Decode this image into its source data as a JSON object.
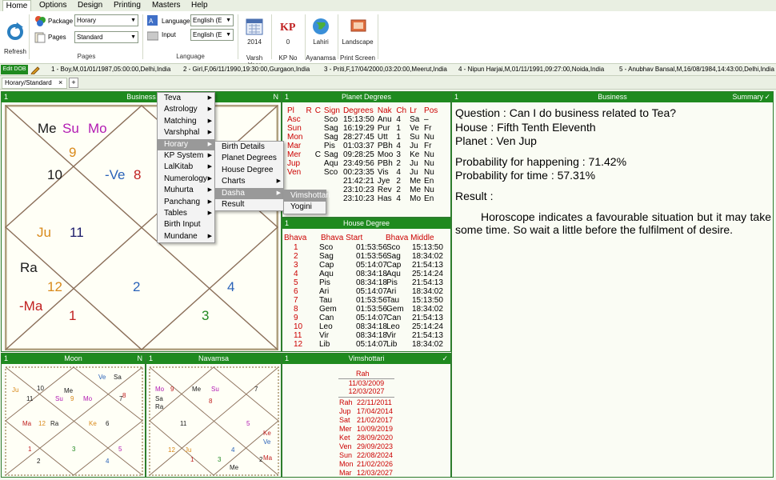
{
  "ribbon_tabs": [
    "Home",
    "Options",
    "Design",
    "Printing",
    "Masters",
    "Help"
  ],
  "ribbon": {
    "refresh_label": "Refresh",
    "package_label": "Package",
    "package_value": "Horary",
    "pages_label": "Pages",
    "pages_value": "Standard",
    "pages_group": "Pages",
    "language_label": "Language",
    "language_value": "English (E",
    "input_label": "Input",
    "input_value": "English (E",
    "language_group": "Language",
    "year_value": "2014",
    "varsh_label": "Varsh Year",
    "kp_value": "0",
    "kp_label": "KP No",
    "ayanamsa_value": "Lahiri",
    "ayanamsa_label": "Ayanamsa",
    "print_value": "Landscape",
    "print_label": "Print Screen"
  },
  "dob_bar": {
    "edit_label": "Edit DOB",
    "entries": [
      "1 - Boy,M,01/01/1987,05:00:00,Delhi,India",
      "2 - Girl,F,06/11/1990,19:30:00,Gurgaon,India",
      "3 - Priti,F,17/04/2000,03:20:00,Meerut,India",
      "4 - Nipun Harjai,M,01/11/1991,09:27:00,Noida,India",
      "5 - Anubhav Bansal,M,16/08/1984,14:43:00,Delhi,India"
    ]
  },
  "doc_tab": {
    "label": "Horary/Standard",
    "close": "×",
    "add": "+"
  },
  "business_panel": {
    "num": "1",
    "title": "Business",
    "right": "N",
    "texts": [
      {
        "t": "Me",
        "c": "#1a1a1a"
      },
      {
        "t": "Su",
        "c": "#b21ab2"
      },
      {
        "t": "Mo",
        "c": "#b21ab2"
      },
      {
        "t": "9",
        "c": "#d98a1a"
      },
      {
        "t": "10",
        "c": "#1a1a1a"
      },
      {
        "t": "-Ve",
        "c": "#2a62b8"
      },
      {
        "t": "8",
        "c": "#c02020"
      },
      {
        "t": "Ju",
        "c": "#d98a1a"
      },
      {
        "t": "11",
        "c": "#1a1a6a"
      },
      {
        "t": "Ra",
        "c": "#1a1a1a"
      },
      {
        "t": "12",
        "c": "#d98a1a"
      },
      {
        "t": "-Ma",
        "c": "#c02020"
      },
      {
        "t": "1",
        "c": "#c02020"
      },
      {
        "t": "2",
        "c": "#2a62b8"
      },
      {
        "t": "4",
        "c": "#2a62b8"
      },
      {
        "t": "3",
        "c": "#238a23"
      }
    ]
  },
  "menu_main": [
    "Teva",
    "Astrology",
    "Matching",
    "Varshphal",
    "Horary",
    "KP System",
    "LalKitab",
    "Numerology",
    "Muhurta",
    "Panchang",
    "Tables",
    "Birth Input",
    "Mundane"
  ],
  "menu_horary": [
    "Birth Details",
    "Planet Degrees",
    "House Degree",
    "Charts",
    "Dasha",
    "Result"
  ],
  "menu_dasha": [
    "Vimshottari",
    "Yogini"
  ],
  "planet_panel": {
    "num": "1",
    "title": "Planet Degrees",
    "headers": [
      "Pl",
      "R",
      "C",
      "Sign",
      "Degrees",
      "Nak",
      "Ch",
      "Lr",
      "Pos"
    ],
    "rows": [
      [
        "Asc",
        "",
        "",
        "Sco",
        "15:13:50",
        "Anu",
        "4",
        "Sa",
        "–"
      ],
      [
        "Sun",
        "",
        "",
        "Sag",
        "16:19:29",
        "Pur",
        "1",
        "Ve",
        "Fr"
      ],
      [
        "Mon",
        "",
        "",
        "Sag",
        "28:27:45",
        "Utt",
        "1",
        "Su",
        "Nu"
      ],
      [
        "Mar",
        "",
        "",
        "Pis",
        "01:03:37",
        "PBh",
        "4",
        "Ju",
        "Fr"
      ],
      [
        "Mer",
        "",
        "C",
        "Sag",
        "09:28:25",
        "Moo",
        "3",
        "Ke",
        "Nu"
      ],
      [
        "Jup",
        "",
        "",
        "Aqu",
        "23:49:56",
        "PBh",
        "2",
        "Ju",
        "Nu"
      ],
      [
        "Ven",
        "",
        "",
        "Sco",
        "00:23:35",
        "Vis",
        "4",
        "Ju",
        "Nu"
      ],
      [
        "",
        "",
        "",
        "",
        "21:42:21",
        "Jye",
        "2",
        "Me",
        "En"
      ],
      [
        "",
        "",
        "",
        "",
        "23:10:23",
        "Rev",
        "2",
        "Me",
        "Nu"
      ],
      [
        "",
        "",
        "",
        "",
        "23:10:23",
        "Has",
        "4",
        "Mo",
        "En"
      ]
    ]
  },
  "house_panel": {
    "num": "1",
    "title": "House Degree",
    "headers": [
      "Bhava",
      "Bhava Start",
      "Bhava Middle"
    ],
    "rows": [
      [
        "1",
        "Sco",
        "01:53:56",
        "Sco",
        "15:13:50"
      ],
      [
        "2",
        "Sag",
        "01:53:56",
        "Sag",
        "18:34:02"
      ],
      [
        "3",
        "Cap",
        "05:14:07",
        "Cap",
        "21:54:13"
      ],
      [
        "4",
        "Aqu",
        "08:34:18",
        "Aqu",
        "25:14:24"
      ],
      [
        "5",
        "Pis",
        "08:34:18",
        "Pis",
        "21:54:13"
      ],
      [
        "6",
        "Ari",
        "05:14:07",
        "Ari",
        "18:34:02"
      ],
      [
        "7",
        "Tau",
        "01:53:56",
        "Tau",
        "15:13:50"
      ],
      [
        "8",
        "Gem",
        "01:53:56",
        "Gem",
        "18:34:02"
      ],
      [
        "9",
        "Can",
        "05:14:07",
        "Can",
        "21:54:13"
      ],
      [
        "10",
        "Leo",
        "08:34:18",
        "Leo",
        "25:14:24"
      ],
      [
        "11",
        "Vir",
        "08:34:18",
        "Vir",
        "21:54:13"
      ],
      [
        "12",
        "Lib",
        "05:14:07",
        "Lib",
        "18:34:02"
      ]
    ]
  },
  "result_panel": {
    "num": "1",
    "title": "Business",
    "right": "Summary",
    "question": "Question : Can I do business related to Tea?",
    "house": "House : Fifth Tenth Eleventh",
    "planet": "Planet : Ven Jup",
    "prob_happen": "Probability for happening : 71.42%",
    "prob_time": "Probability for time : 57.31%",
    "result_label": "Result :",
    "result_text": "Horoscope indicates a favourable situation but it may take some time. So wait a little before the fulfilment of desire."
  },
  "moon_panel": {
    "num": "1",
    "title": "Moon",
    "right": "N",
    "texts": [
      {
        "t": "Ve",
        "c": "#2a62b8"
      },
      {
        "t": "Sa",
        "c": "#1a1a1a"
      },
      {
        "t": "10",
        "c": "#1a1a1a"
      },
      {
        "t": "Ju",
        "c": "#d98a1a"
      },
      {
        "t": "Me",
        "c": "#1a1a1a"
      },
      {
        "t": "8",
        "c": "#c02020"
      },
      {
        "t": "11",
        "c": "#1a1a1a"
      },
      {
        "t": "Su",
        "c": "#b21ab2"
      },
      {
        "t": "9",
        "c": "#d98a1a"
      },
      {
        "t": "Mo",
        "c": "#b21ab2"
      },
      {
        "t": "7",
        "c": "#1a1a1a"
      },
      {
        "t": "Ma",
        "c": "#c02020"
      },
      {
        "t": "12",
        "c": "#d98a1a"
      },
      {
        "t": "Ra",
        "c": "#1a1a1a"
      },
      {
        "t": "Ke",
        "c": "#d98a1a"
      },
      {
        "t": "6",
        "c": "#1a1a1a"
      },
      {
        "t": "1",
        "c": "#c02020"
      },
      {
        "t": "3",
        "c": "#238a23"
      },
      {
        "t": "5",
        "c": "#b21ab2"
      },
      {
        "t": "2",
        "c": "#1a1a1a"
      },
      {
        "t": "4",
        "c": "#2a62b8"
      }
    ]
  },
  "navamsa_panel": {
    "num": "1",
    "title": "Navamsa",
    "texts": [
      {
        "t": "Mo",
        "c": "#b21ab2"
      },
      {
        "t": "Sa",
        "c": "#1a1a1a"
      },
      {
        "t": "9",
        "c": "#c02020"
      },
      {
        "t": "7",
        "c": "#1a1a1a"
      },
      {
        "t": "Ra",
        "c": "#1a1a1a"
      },
      {
        "t": "8",
        "c": "#c02020"
      },
      {
        "t": "Me",
        "c": "#1a1a1a"
      },
      {
        "t": "Su",
        "c": "#b21ab2"
      },
      {
        "t": "11",
        "c": "#1a1a1a"
      },
      {
        "t": "5",
        "c": "#b21ab2"
      },
      {
        "t": "Ke",
        "c": "#c02020"
      },
      {
        "t": "Ve",
        "c": "#2a62b8"
      },
      {
        "t": "12",
        "c": "#d98a1a"
      },
      {
        "t": "Ju",
        "c": "#d98a1a"
      },
      {
        "t": "4",
        "c": "#2a62b8"
      },
      {
        "t": "Ma",
        "c": "#c02020"
      },
      {
        "t": "1",
        "c": "#c02020"
      },
      {
        "t": "3",
        "c": "#238a23"
      },
      {
        "t": "2",
        "c": "#1a1a1a"
      },
      {
        "t": "Me",
        "c": "#1a1a1a"
      }
    ]
  },
  "vim_panel": {
    "num": "1",
    "title": "Vimshottari",
    "head": "Rah",
    "from": "11/03/2009",
    "to": "12/03/2027",
    "rows": [
      [
        "Rah",
        "22/11/2011"
      ],
      [
        "Jup",
        "17/04/2014"
      ],
      [
        "Sat",
        "21/02/2017"
      ],
      [
        "Mer",
        "10/09/2019"
      ],
      [
        "Ket",
        "28/09/2020"
      ],
      [
        "Ven",
        "29/09/2023"
      ],
      [
        "Sun",
        "22/08/2024"
      ],
      [
        "Mon",
        "21/02/2026"
      ],
      [
        "Mar",
        "12/03/2027"
      ]
    ]
  }
}
